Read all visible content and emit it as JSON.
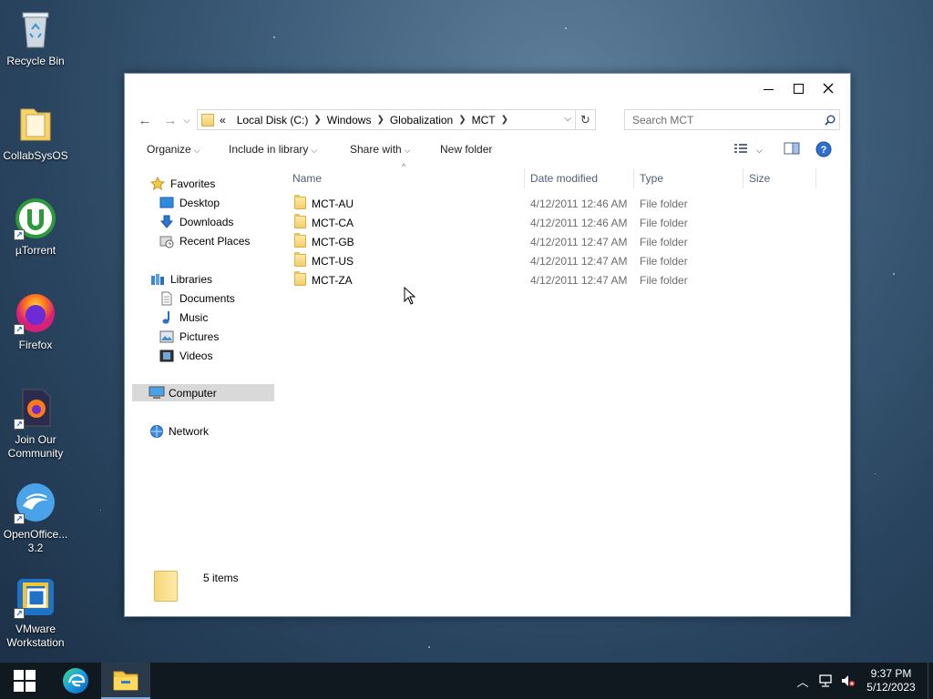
{
  "desktop": {
    "icons": [
      {
        "label": "Recycle Bin",
        "icon": "recycle-bin-icon"
      },
      {
        "label": "CollabSysOS",
        "icon": "folder-icon"
      },
      {
        "label": "µTorrent",
        "icon": "utorrent-icon"
      },
      {
        "label": "Firefox",
        "icon": "firefox-icon"
      },
      {
        "label": "Join Our Community",
        "icon": "firefox-document-icon"
      },
      {
        "label": "OpenOffice... 3.2",
        "icon": "openoffice-icon"
      },
      {
        "label": "VMware Workstation",
        "icon": "vmware-icon"
      }
    ]
  },
  "explorer": {
    "address": {
      "overflow": "«",
      "crumbs": [
        "Local Disk (C:)",
        "Windows",
        "Globalization",
        "MCT"
      ]
    },
    "search_placeholder": "Search MCT",
    "toolbar": {
      "organize": "Organize",
      "include_in_library": "Include in library",
      "share_with": "Share with",
      "new_folder": "New folder"
    },
    "nav": {
      "favorites": "Favorites",
      "desktop": "Desktop",
      "downloads": "Downloads",
      "recent_places": "Recent Places",
      "libraries": "Libraries",
      "documents": "Documents",
      "music": "Music",
      "pictures": "Pictures",
      "videos": "Videos",
      "computer": "Computer",
      "network": "Network"
    },
    "columns": {
      "name": "Name",
      "date_modified": "Date modified",
      "type": "Type",
      "size": "Size"
    },
    "files": [
      {
        "name": "MCT-AU",
        "date": "4/12/2011 12:46 AM",
        "type": "File folder"
      },
      {
        "name": "MCT-CA",
        "date": "4/12/2011 12:46 AM",
        "type": "File folder"
      },
      {
        "name": "MCT-GB",
        "date": "4/12/2011 12:47 AM",
        "type": "File folder"
      },
      {
        "name": "MCT-US",
        "date": "4/12/2011 12:47 AM",
        "type": "File folder"
      },
      {
        "name": "MCT-ZA",
        "date": "4/12/2011 12:47 AM",
        "type": "File folder"
      }
    ],
    "status": "5 items"
  },
  "taskbar": {
    "time": "9:37 PM",
    "date": "5/12/2023"
  },
  "colors": {
    "selected_nav": "#d9d9d9",
    "taskbar": "#101820",
    "link_blue": "#1e6fd9"
  }
}
